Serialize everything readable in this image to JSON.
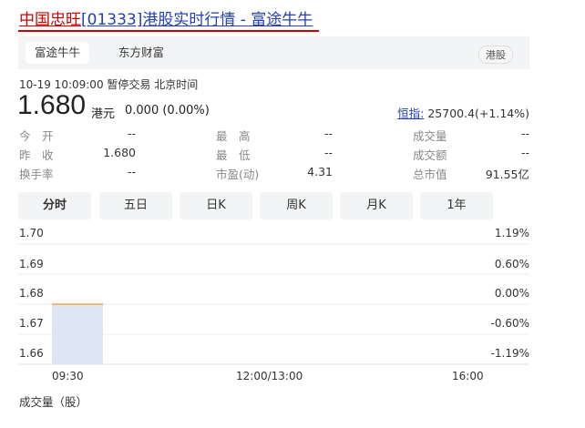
{
  "header": {
    "title_name": "中国忠旺",
    "title_code": "[01333]",
    "title_rest": "港股实时行情 - 富途牛牛"
  },
  "source_tabs": [
    {
      "label": "富途牛牛",
      "active": true
    },
    {
      "label": "东方财富",
      "active": false
    }
  ],
  "market_badge": "港股",
  "quote": {
    "meta": "10-19 10:09:00   暂停交易   北京时间",
    "price": "1.680",
    "unit": "港元",
    "change": "0.000 (0.00%)",
    "index_label": "恒指:",
    "index_value": "25700.4(+1.14%)"
  },
  "stats": [
    {
      "label": "今　开",
      "value": "--"
    },
    {
      "label": "最　高",
      "value": "--"
    },
    {
      "label": "成交量",
      "value": "--"
    },
    {
      "label": "昨　收",
      "value": "1.680"
    },
    {
      "label": "最　低",
      "value": "--"
    },
    {
      "label": "成交额",
      "value": "--"
    },
    {
      "label": "换手率",
      "value": "--"
    },
    {
      "label": "市盈(动)",
      "value": "4.31"
    },
    {
      "label": "总市值",
      "value": "91.55亿"
    }
  ],
  "chart_tabs": [
    {
      "label": "分时",
      "active": true
    },
    {
      "label": "五日",
      "active": false
    },
    {
      "label": "日K",
      "active": false
    },
    {
      "label": "周K",
      "active": false
    },
    {
      "label": "月K",
      "active": false
    },
    {
      "label": "1年",
      "active": false
    }
  ],
  "chart_data": {
    "type": "line",
    "y_ticks": [
      "1.70",
      "1.69",
      "1.68",
      "1.67",
      "1.66"
    ],
    "pct_ticks": [
      "1.19%",
      "0.60%",
      "0.00%",
      "-0.60%",
      "-1.19%"
    ],
    "x_ticks": [
      "09:30",
      "12:00/13:00",
      "16:00"
    ],
    "ylim": [
      1.66,
      1.7
    ],
    "x": [
      "09:30",
      "10:09"
    ],
    "series": [
      {
        "values": [
          1.68,
          1.68
        ]
      }
    ],
    "area_color": "#dde4f3",
    "line_color": "#e8a94a"
  },
  "volume_label": "成交量（股）"
}
